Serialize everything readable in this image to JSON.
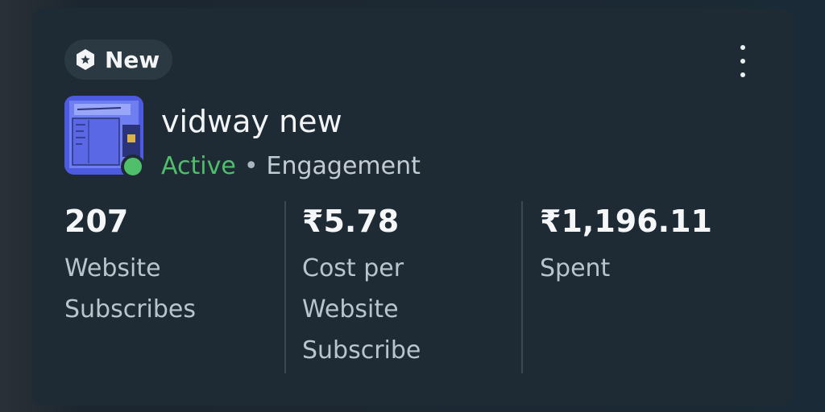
{
  "badge": {
    "label": "New",
    "icon": "badge-star-icon"
  },
  "menu": {
    "icon": "more-vertical-icon"
  },
  "campaign": {
    "name": "vidway new",
    "status": "Active",
    "separator": "•",
    "objective": "Engagement",
    "status_color": "#4fbf6b"
  },
  "metrics": [
    {
      "value": "207",
      "label_lines": [
        "Website",
        "Subscribes"
      ]
    },
    {
      "value": "₹5.78",
      "label_lines": [
        "Cost per",
        "Website",
        "Subscribe"
      ]
    },
    {
      "value": "₹1,196.11",
      "label_lines": [
        "Spent"
      ]
    }
  ],
  "colors": {
    "card_bg": "#1e2b34",
    "badge_bg": "#2a3942",
    "text_primary": "#f2f4f5",
    "text_secondary": "#b9c4cc",
    "active_green": "#4fbf6b"
  }
}
